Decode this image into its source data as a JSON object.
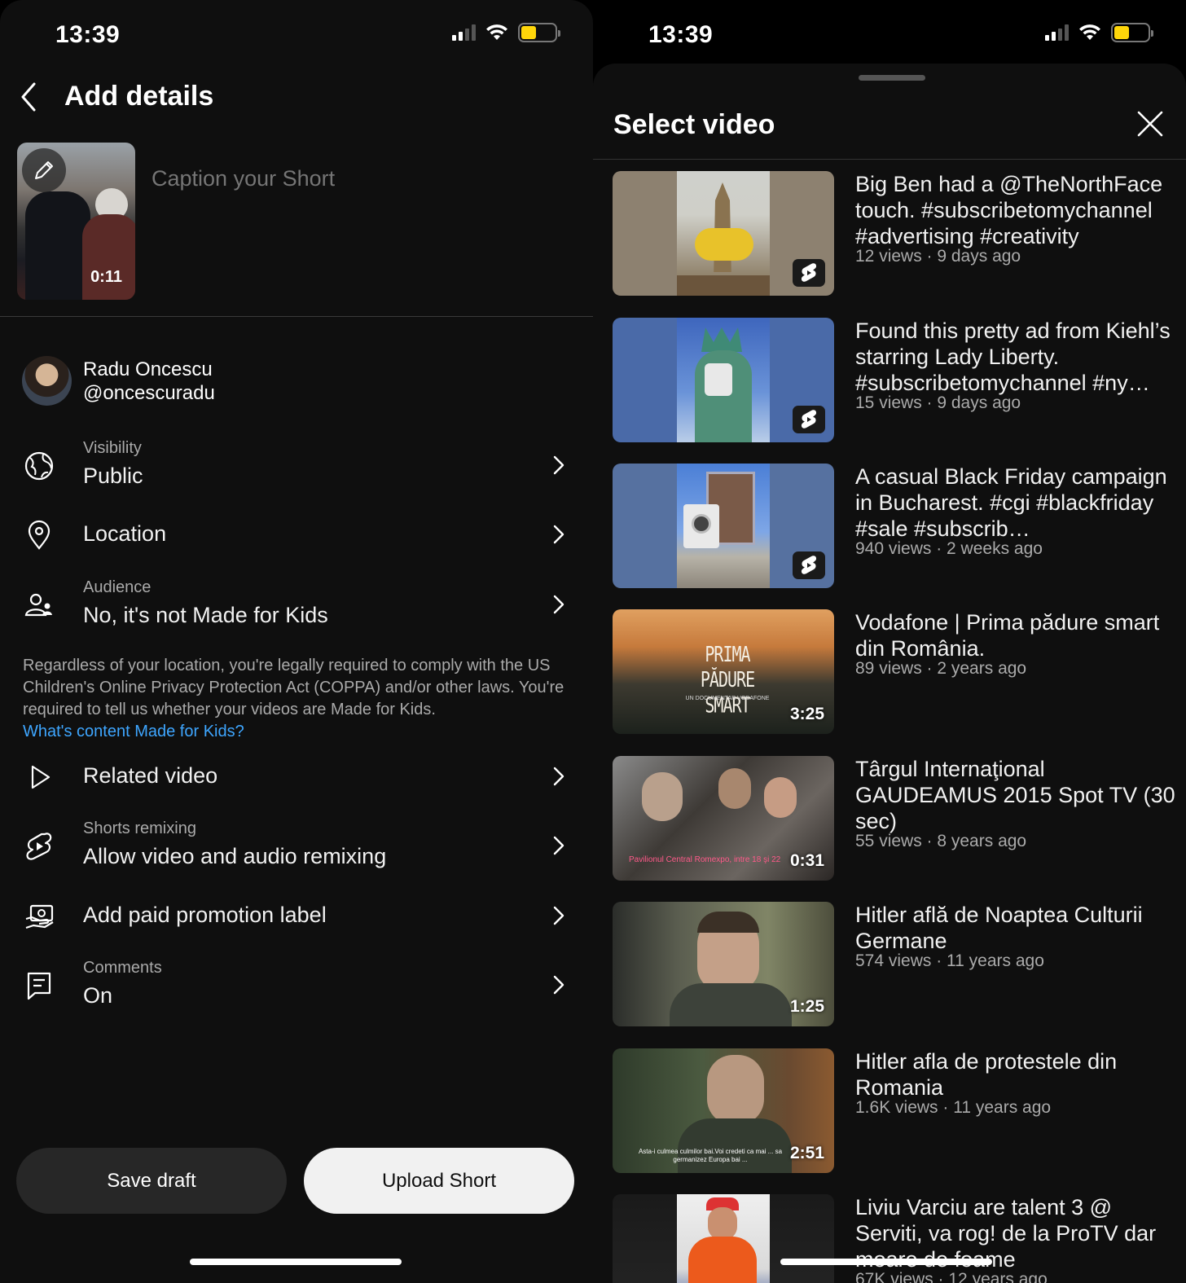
{
  "status_bar": {
    "time": "13:39"
  },
  "left": {
    "title": "Add details",
    "thumbnail_duration": "0:11",
    "caption_placeholder": "Caption your Short",
    "account": {
      "name": "Radu Oncescu",
      "handle": "@oncescuradu"
    },
    "rows": {
      "visibility": {
        "small": "Visibility",
        "main": "Public"
      },
      "location": {
        "main": "Location"
      },
      "audience": {
        "small": "Audience",
        "main": "No, it's not Made for Kids"
      },
      "related": {
        "main": "Related video"
      },
      "remixing": {
        "small": "Shorts remixing",
        "main": "Allow video and audio remixing"
      },
      "paid": {
        "main": "Add paid promotion label"
      },
      "comments": {
        "small": "Comments",
        "main": "On"
      }
    },
    "notice": "Regardless of your location, you're legally required to comply with the US Children's Online Privacy Protection Act (COPPA) and/or other laws. You're required to tell us whether your videos are Made for Kids.",
    "notice_link": "What's content Made for Kids?",
    "buttons": {
      "save": "Save draft",
      "upload": "Upload Short"
    }
  },
  "right": {
    "title": "Select video",
    "videos": [
      {
        "title": "Big Ben had a @TheNorthFace touch. #subscribetomychannel #advertising #creativity",
        "meta": "12 views · 9 days ago",
        "badge": "shorts-icon"
      },
      {
        "title": "Found this pretty ad from Kiehl’s starring Lady Liberty. #subscribetomychannel #ny…",
        "meta": "15 views · 9 days ago",
        "badge": "shorts-icon"
      },
      {
        "title": "A casual Black Friday campaign in Bucharest. #cgi #blackfriday #sale #subscrib…",
        "meta": "940 views · 2 weeks ago",
        "badge": "shorts-icon"
      },
      {
        "title": "Vodafone | Prima pădure smart din România.",
        "meta": "89 views · 2 years ago",
        "duration": "3:25",
        "thumb_text": "PRIMA PĂDURE SMART",
        "thumb_sub": "UN DOCUMENTAR VODAFONE"
      },
      {
        "title": "Târgul Internaţional GAUDEAMUS 2015 Spot  TV (30 sec)",
        "meta": "55 views · 8 years ago",
        "duration": "0:31",
        "thumb_text": "Pavilionul Central Romexpo, intre 18 şi 22"
      },
      {
        "title": "Hitler află de Noaptea Culturii Germane",
        "meta": "574 views · 11 years ago",
        "duration": "1:25"
      },
      {
        "title": "Hitler afla de protestele din Romania",
        "meta": "1.6K views · 11 years ago",
        "duration": "2:51",
        "thumb_text": "Asta-i culmea culmilor bai.Voi credeti ca mai ... sa germanizez Europa bai ..."
      },
      {
        "title": "Liviu Varciu are talent 3 @ Serviti, va rog! de la ProTV dar moare de foame",
        "meta": "67K views · 12 years ago"
      }
    ]
  }
}
